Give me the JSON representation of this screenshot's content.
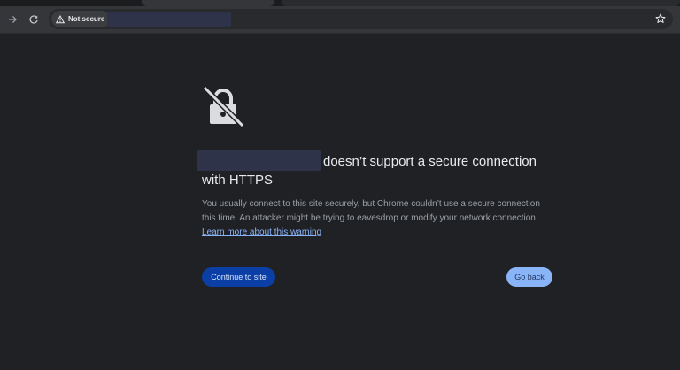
{
  "toolbar": {
    "back_icon": "arrow-right-icon",
    "reload_icon": "reload-icon",
    "security_label": "Not secure",
    "security_icon": "warning-triangle-icon",
    "bookmark_icon": "star-icon"
  },
  "interstitial": {
    "icon": "crossed-out-lock-icon",
    "heading_suffix": "doesn’t support a secure connection with HTTPS",
    "body_text": "You usually connect to this site securely, but Chrome couldn’t use a secure connection this time. An attacker might be trying to eavesdrop or modify your network connection. ",
    "learn_more_link": "Learn more about this warning",
    "continue_button": "Continue to site",
    "back_button": "Go back"
  },
  "colors": {
    "page_background": "#202124",
    "primary_button": "#0b3fa5",
    "secondary_button": "#8ab4f8",
    "link": "#8ab4f8"
  }
}
